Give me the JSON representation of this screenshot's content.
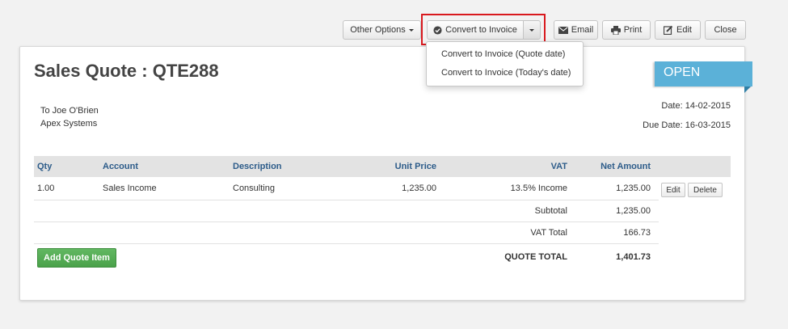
{
  "toolbar": {
    "other_options": "Other Options",
    "convert_to_invoice": "Convert to Invoice",
    "email": "Email",
    "print": "Print",
    "edit": "Edit",
    "close": "Close"
  },
  "dropdown": {
    "items": [
      "Convert to Invoice (Quote date)",
      "Convert to Invoice (Today's date)"
    ]
  },
  "quote": {
    "title": "Sales Quote : QTE288",
    "status": "OPEN",
    "to_line1": "To Joe O'Brien",
    "to_line2": "Apex Systems",
    "date": "Date: 14-02-2015",
    "due_date": "Due Date: 16-03-2015"
  },
  "table": {
    "headers": {
      "qty": "Qty",
      "account": "Account",
      "description": "Description",
      "unit_price": "Unit Price",
      "vat": "VAT",
      "net_amount": "Net Amount"
    },
    "rows": [
      {
        "qty": "1.00",
        "account": "Sales Income",
        "description": "Consulting",
        "unit_price": "1,235.00",
        "vat": "13.5% Income",
        "net_amount": "1,235.00"
      }
    ],
    "row_edit": "Edit",
    "row_delete": "Delete",
    "subtotal_label": "Subtotal",
    "subtotal_value": "1,235.00",
    "vat_total_label": "VAT Total",
    "vat_total_value": "166.73",
    "quote_total_label": "QUOTE TOTAL",
    "quote_total_value": "1,401.73",
    "add_item": "Add Quote Item"
  },
  "colors": {
    "accent_blue": "#5bb1d8",
    "highlight_red": "#d9191e",
    "add_green": "#4aa14a",
    "header_text": "#2d5c8a"
  }
}
